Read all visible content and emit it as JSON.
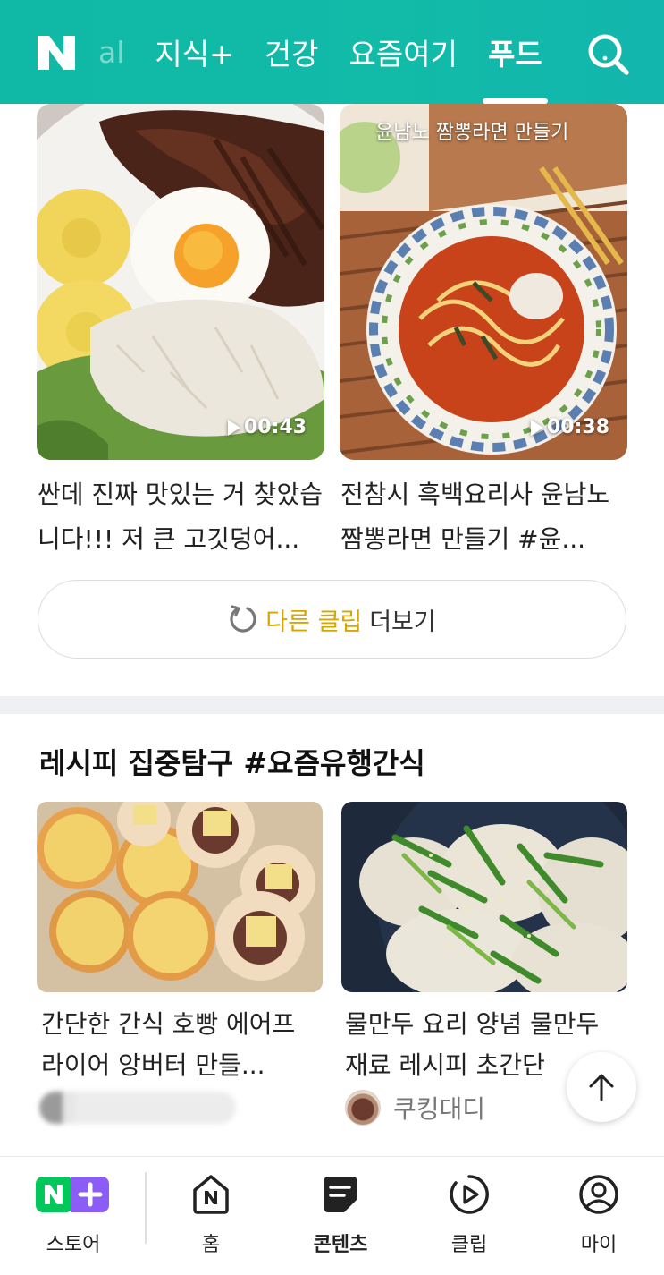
{
  "header": {
    "logo": "N",
    "tabs": [
      {
        "label": "al",
        "state": "faded"
      },
      {
        "label": "지식+",
        "state": "normal"
      },
      {
        "label": "건강",
        "state": "normal"
      },
      {
        "label": "요즘여기",
        "state": "normal"
      },
      {
        "label": "푸드",
        "state": "active"
      }
    ],
    "search_icon": "search-icon",
    "colors": {
      "bg": "#11bba8",
      "text": "#ffffff"
    }
  },
  "clips": [
    {
      "duration": "00:43",
      "title": "싼데 진짜 맛있는 거 찾았습니다!!! 저 큰 고깃덩어..."
    },
    {
      "duration": "00:38",
      "overlay_text": "윤남노 짬뽕라면 만들기",
      "title": "전참시 흑백요리사 윤남노 짬뽕라면 만들기 #윤..."
    }
  ],
  "more_button": {
    "accent": "다른 클립",
    "rest": "더보기",
    "accent_color": "#d7a600"
  },
  "section": {
    "title": "레시피 집중탐구 #요즘유행간식"
  },
  "recipes": [
    {
      "title": "간단한 간식 호빵 에어프라이어 앙버터 만들...",
      "author": ""
    },
    {
      "title": "물만두 요리 양념 물만두 재료 레시피 초간단",
      "author": "쿠킹대디"
    }
  ],
  "bottom_nav": [
    {
      "label": "스토어",
      "icon": "naver-plus-store-icon",
      "active": false
    },
    {
      "label": "홈",
      "icon": "home-icon",
      "active": false
    },
    {
      "label": "콘텐츠",
      "icon": "contents-icon",
      "active": true
    },
    {
      "label": "클립",
      "icon": "clip-play-icon",
      "active": false
    },
    {
      "label": "마이",
      "icon": "profile-icon",
      "active": false
    }
  ]
}
